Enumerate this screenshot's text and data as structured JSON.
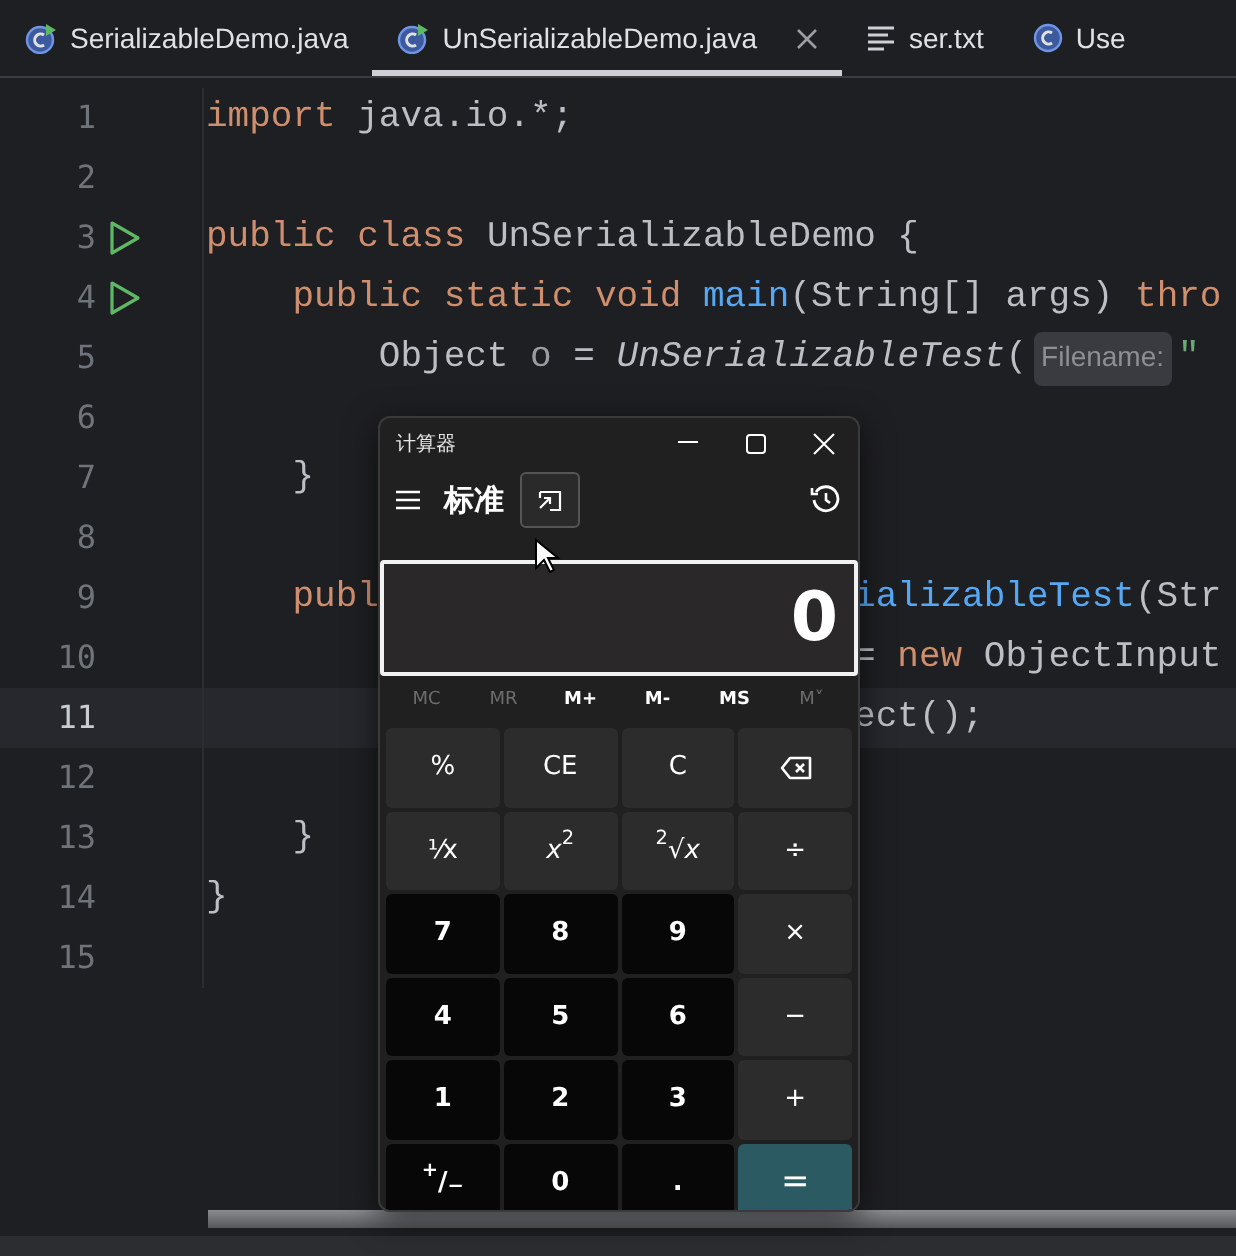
{
  "tabs": [
    {
      "label": "SerializableDemo.java",
      "kind": "runnable",
      "selected": false,
      "closable": false
    },
    {
      "label": "UnSerializableDemo.java",
      "kind": "runnable",
      "selected": true,
      "closable": true
    },
    {
      "label": "ser.txt",
      "kind": "text",
      "selected": false,
      "closable": false
    },
    {
      "label": "Use",
      "kind": "class",
      "selected": false,
      "closable": false
    }
  ],
  "editor": {
    "lines": [
      {
        "number": "1",
        "tokens": [
          {
            "text": "import",
            "kind": "keyword"
          },
          {
            "text": " java.io.*;",
            "kind": "plain"
          }
        ]
      },
      {
        "number": "2"
      },
      {
        "number": "3",
        "run": true,
        "tokens": [
          {
            "text": "public class",
            "kind": "keyword"
          },
          {
            "text": " UnSerializableDemo {",
            "kind": "plain"
          }
        ]
      },
      {
        "number": "4",
        "run": true,
        "tokens": [
          {
            "text": "    public static void",
            "kind": "keyword"
          },
          {
            "text": " main",
            "kind": "method"
          },
          {
            "text": "(String[] args) ",
            "kind": "plain"
          },
          {
            "text": "thro",
            "kind": "keyword"
          }
        ]
      },
      {
        "number": "5",
        "tokens": [
          {
            "text": "        Object ",
            "kind": "plain"
          },
          {
            "text": "o",
            "kind": "unused"
          },
          {
            "text": " = ",
            "kind": "plain"
          },
          {
            "text": "UnSerializableTest",
            "kind": "static-call"
          },
          {
            "text": "(",
            "kind": "plain"
          },
          {
            "text": "Filename:",
            "kind": "hint"
          },
          {
            "text": "\"",
            "kind": "string"
          }
        ]
      },
      {
        "number": "6"
      },
      {
        "number": "7",
        "tokens": [
          {
            "text": "    }",
            "kind": "plain"
          }
        ]
      },
      {
        "number": "8"
      },
      {
        "number": "9",
        "tokens": [
          {
            "text": "    publ",
            "kind": "keyword"
          }
        ],
        "tokens_right": [
          {
            "text": "ializableTest",
            "kind": "method"
          },
          {
            "text": "(Str",
            "kind": "plain"
          }
        ]
      },
      {
        "number": "10",
        "tokens_right": [
          {
            "text": "= ",
            "kind": "plain"
          },
          {
            "text": "new",
            "kind": "keyword"
          },
          {
            "text": " ObjectInput",
            "kind": "plain"
          }
        ]
      },
      {
        "number": "11",
        "current": true,
        "tokens_right": [
          {
            "text": "ect();",
            "kind": "plain"
          }
        ]
      },
      {
        "number": "12"
      },
      {
        "number": "13",
        "tokens": [
          {
            "text": "    }",
            "kind": "plain"
          }
        ]
      },
      {
        "number": "14",
        "tokens": [
          {
            "text": "}",
            "kind": "plain"
          }
        ]
      },
      {
        "number": "15"
      }
    ]
  },
  "calculator": {
    "title": "计算器",
    "mode": "标准",
    "display": "0",
    "memory": [
      {
        "label": "MC",
        "disabled": true
      },
      {
        "label": "MR",
        "disabled": true
      },
      {
        "label": "M+",
        "disabled": false
      },
      {
        "label": "M-",
        "disabled": false
      },
      {
        "label": "MS",
        "disabled": false
      },
      {
        "label": "M˅",
        "disabled": true
      }
    ],
    "keys": [
      {
        "label": "%",
        "kind": "function"
      },
      {
        "label": "CE",
        "kind": "function"
      },
      {
        "label": "C",
        "kind": "function"
      },
      {
        "kind": "backspace"
      },
      {
        "label": "⅟x",
        "kind": "function"
      },
      {
        "label": "*x*$^{2}$",
        "kind": "function"
      },
      {
        "label": "$^{2}$√*x*",
        "kind": "function"
      },
      {
        "label": "÷",
        "kind": "function"
      },
      {
        "label": "7",
        "kind": "digit"
      },
      {
        "label": "8",
        "kind": "digit"
      },
      {
        "label": "9",
        "kind": "digit"
      },
      {
        "label": "×",
        "kind": "function"
      },
      {
        "label": "4",
        "kind": "digit"
      },
      {
        "label": "5",
        "kind": "digit"
      },
      {
        "label": "6",
        "kind": "digit"
      },
      {
        "label": "−",
        "kind": "function"
      },
      {
        "label": "1",
        "kind": "digit"
      },
      {
        "label": "2",
        "kind": "digit"
      },
      {
        "label": "3",
        "kind": "digit"
      },
      {
        "label": "+",
        "kind": "function"
      },
      {
        "label": "$^{+}$/$_{−}$",
        "kind": "digit"
      },
      {
        "label": "0",
        "kind": "digit"
      },
      {
        "label": ".",
        "kind": "digit"
      },
      {
        "label": "=",
        "kind": "equals"
      }
    ]
  }
}
